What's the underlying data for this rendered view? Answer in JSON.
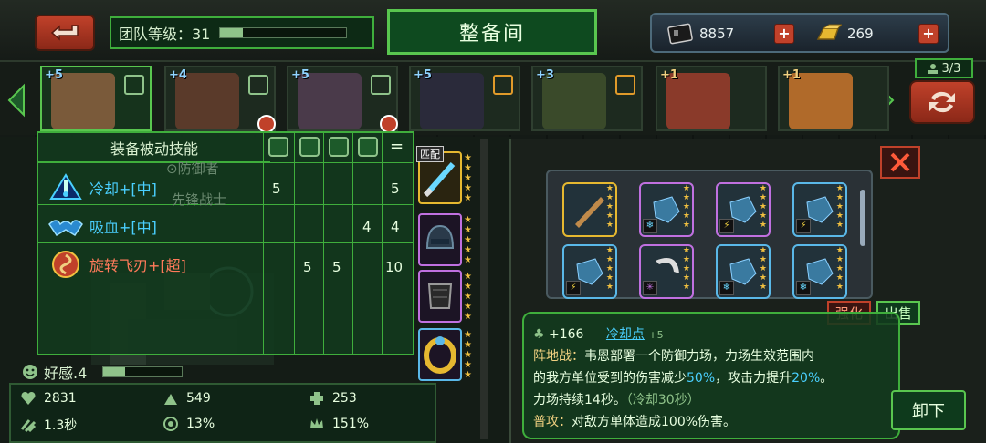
{
  "top": {
    "team_label": "团队等级：31",
    "team_progress": 0.18,
    "title": "整备间",
    "resource1": "8857",
    "resource2": "269"
  },
  "heroes": [
    {
      "stars": "+5",
      "class": "person"
    },
    {
      "stars": "+4",
      "class": "person"
    },
    {
      "stars": "+5",
      "class": "person"
    },
    {
      "stars": "+5",
      "class": "arrow"
    },
    {
      "stars": "+3",
      "class": "arrow"
    },
    {
      "stars": "+1",
      "class": ""
    },
    {
      "stars": "+1",
      "class": ""
    }
  ],
  "hero_count": "3/3",
  "passive": {
    "header": "装备被动技能",
    "skills": [
      {
        "name": "冷却+[中]",
        "color": "#4ad0ff"
      },
      {
        "name": "吸血+[中]",
        "color": "#4ad0ff"
      },
      {
        "name": "旋转飞刃+[超]",
        "color": "#ff7a5a"
      }
    ],
    "ghost1": "⊙防御者",
    "ghost2": "先锋战士",
    "values": {
      "r1c1": "5",
      "r1total": "5",
      "r2c4": "4",
      "r2total": "4",
      "r3c2": "5",
      "r3c3": "5",
      "r3total": "10"
    },
    "eq_sign": "="
  },
  "favor": "好感.4",
  "favor_level": 0.28,
  "stats": {
    "hp": "2831",
    "attack": "549",
    "defense": "253",
    "speed": "1.3秒",
    "crit": "13%",
    "crit_dmg": "151%"
  },
  "slot_tag": "匹配",
  "buttons": {
    "enhance": "强化",
    "sell": "出售",
    "unequip": "卸下"
  },
  "item_desc": {
    "bonus": "+166",
    "name": "冷却点",
    "name_lvl": "+5",
    "line1_pre": "阵地战：",
    "line1": "韦恩部署一个防御力场，力场生效范围内",
    "line2a": "的我方单位受到的伤害减少",
    "line2b": "50%",
    "line2c": "，攻击力提升",
    "line2d": "20%",
    "line2e": "。",
    "line3a": "力场持续14秒。",
    "line3b": "（冷却30秒）",
    "line4_pre": "普攻：",
    "line4": "对敌方单体造成100%伤害。"
  },
  "colors": {
    "accent_green": "#59c64f",
    "highlight_blue": "#4ad0ff",
    "red_button": "#c0412a"
  }
}
